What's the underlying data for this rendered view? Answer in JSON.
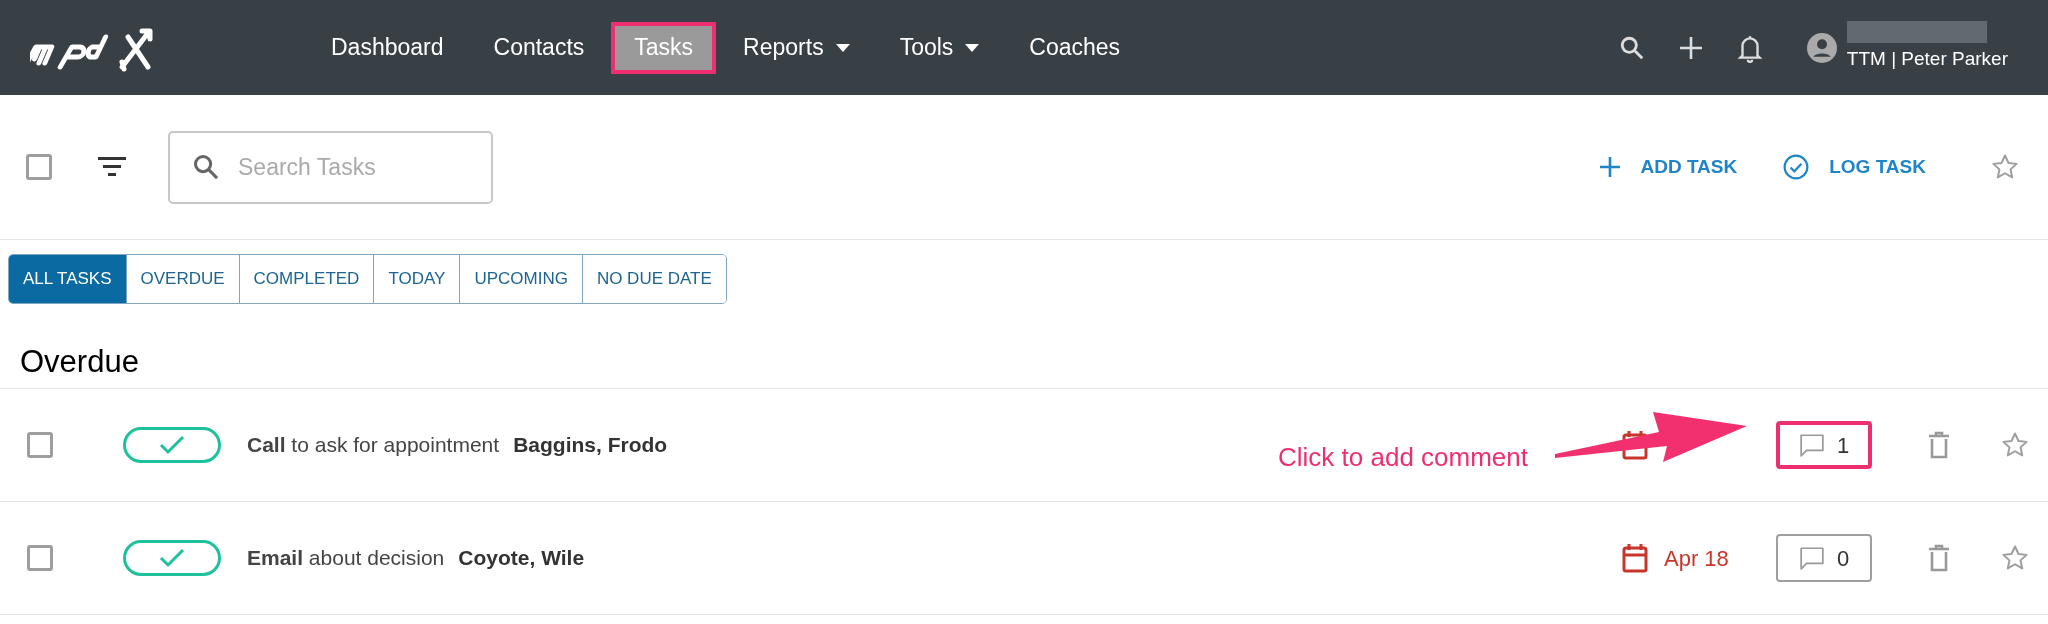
{
  "nav": {
    "items": [
      {
        "label": "Dashboard",
        "selected": false,
        "highlighted": false,
        "dropdown": false
      },
      {
        "label": "Contacts",
        "selected": false,
        "highlighted": false,
        "dropdown": false
      },
      {
        "label": "Tasks",
        "selected": true,
        "highlighted": true,
        "dropdown": false
      },
      {
        "label": "Reports",
        "selected": false,
        "highlighted": false,
        "dropdown": true
      },
      {
        "label": "Tools",
        "selected": false,
        "highlighted": false,
        "dropdown": true
      },
      {
        "label": "Coaches",
        "selected": false,
        "highlighted": false,
        "dropdown": false
      }
    ],
    "user": {
      "account": "TTM | Peter Parker"
    }
  },
  "toolbar": {
    "select_all": {
      "checked": false
    },
    "search": {
      "placeholder": "Search Tasks"
    },
    "actions": [
      {
        "kind": "add",
        "label": "ADD TASK"
      },
      {
        "kind": "log",
        "label": "LOG TASK"
      }
    ],
    "starred": false
  },
  "tabs": [
    {
      "label": "ALL TASKS",
      "selected": true
    },
    {
      "label": "OVERDUE",
      "selected": false
    },
    {
      "label": "COMPLETED",
      "selected": false
    },
    {
      "label": "TODAY",
      "selected": false
    },
    {
      "label": "UPCOMING",
      "selected": false
    },
    {
      "label": "NO DUE DATE",
      "selected": false
    }
  ],
  "section": {
    "title": "Overdue"
  },
  "tasks": [
    {
      "checked": false,
      "summary": "**Call** to ask for appointment",
      "contact": "Baggins, Frodo",
      "comments": "1",
      "highlighted": true,
      "starred": false
    },
    {
      "checked": false,
      "summary": "**Email** about decision",
      "contact": "Coyote, Wile",
      "due": "Apr 18",
      "comments": "0",
      "highlighted": false,
      "starred": false
    }
  ],
  "annotation": {
    "text": "Click to add comment"
  }
}
